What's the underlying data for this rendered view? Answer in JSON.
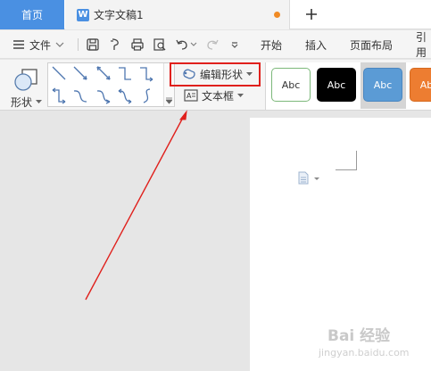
{
  "tabbar": {
    "home_label": "首页",
    "doc_title": "文字文稿1",
    "doc_logo": "W",
    "new_tab_icon": "plus-icon",
    "unsaved_color": "#f08a24",
    "home_color": "#4a90e2"
  },
  "menu": {
    "file_label": "文件",
    "tabs": [
      "开始",
      "插入",
      "页面布局",
      "引用"
    ]
  },
  "ribbon": {
    "shape_label": "形状",
    "edit_shape_label": "编辑形状",
    "textbox_label": "文本框",
    "styles": [
      {
        "label": "Abc",
        "bg": "#ffffff",
        "border": "#7cb87a",
        "color": "#333333"
      },
      {
        "label": "Abc",
        "bg": "#000000",
        "border": "#000000",
        "color": "#ffffff"
      },
      {
        "label": "Abc",
        "bg": "#5b9bd5",
        "border": "#4a86c0",
        "color": "#ffffff"
      },
      {
        "label": "Abc",
        "bg": "#ed7d31",
        "border": "#d56a1f",
        "color": "#ffffff"
      }
    ],
    "highlight_color": "#e0201c"
  },
  "annotation": {
    "arrow_color": "#e0201c"
  },
  "watermark": {
    "main": "Bai 经验",
    "sub": "jingyan.baidu.com"
  }
}
